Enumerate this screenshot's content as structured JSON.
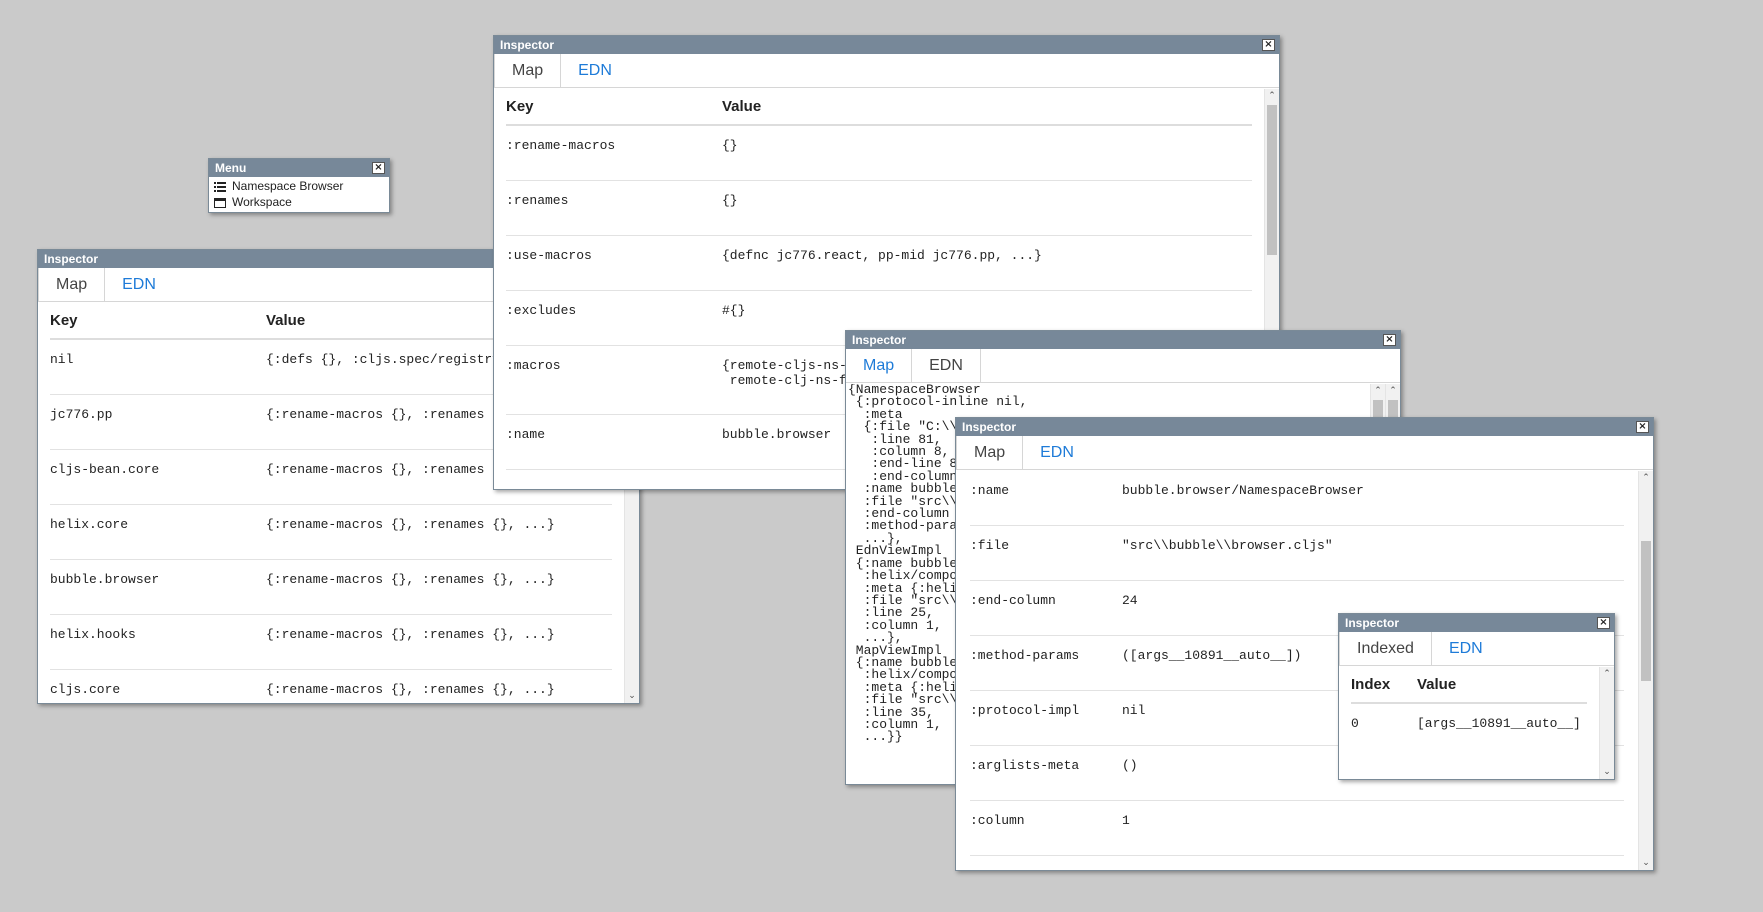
{
  "colors": {
    "background": "#cacaca",
    "titlebar": "#778899",
    "link_tab": "#1e7bd8"
  },
  "close_glyph": "×",
  "menu": {
    "title": "Menu",
    "items": [
      {
        "icon": "list-icon",
        "label": "Namespace Browser"
      },
      {
        "icon": "window-icon",
        "label": "Workspace"
      }
    ]
  },
  "inspector_left": {
    "title": "Inspector",
    "tabs": [
      "Map",
      "EDN"
    ],
    "active_tab": "Map",
    "headers": {
      "key": "Key",
      "value": "Value"
    },
    "rows": [
      {
        "key": "nil",
        "value": "{:defs {}, :cljs.spec/registry-ref []}"
      },
      {
        "key": "jc776.pp",
        "value": "{:rename-macros {}, :renames {}, ...}"
      },
      {
        "key": "cljs-bean.core",
        "value": "{:rename-macros {}, :renames {}, ...}"
      },
      {
        "key": "helix.core",
        "value": "{:rename-macros {}, :renames {}, ...}"
      },
      {
        "key": "bubble.browser",
        "value": "{:rename-macros {}, :renames {}, ...}"
      },
      {
        "key": "helix.hooks",
        "value": "{:rename-macros {}, :renames {}, ...}"
      },
      {
        "key": "cljs.core",
        "value": "{:rename-macros {}, :renames {}, ...}"
      }
    ]
  },
  "inspector_top": {
    "title": "Inspector",
    "tabs": [
      "Map",
      "EDN"
    ],
    "active_tab": "Map",
    "headers": {
      "key": "Key",
      "value": "Value"
    },
    "rows": [
      {
        "key": ":rename-macros",
        "value": "{}"
      },
      {
        "key": ":renames",
        "value": "{}"
      },
      {
        "key": ":use-macros",
        "value": "{defnc jc776.react, pp-mid jc776.pp, ...}"
      },
      {
        "key": ":excludes",
        "value": "#{}"
      },
      {
        "key": ":macros",
        "value": "{remote-cljs-ns-fn bubble.macros,\n remote-clj-ns-fn bubble.macros}"
      },
      {
        "key": ":name",
        "value": "bubble.browser"
      }
    ]
  },
  "inspector_edn": {
    "title": "Inspector",
    "tabs": [
      "Map",
      "EDN"
    ],
    "active_tab": "EDN",
    "text": "{NamespaceBrowser\n {:protocol-inline nil,\n  :meta\n  {:file \"C:\\\\Users\\\\jc776\\\\bubble\\\\src\\\\bubble\\\\browser.cljs\",\n   :line 81,\n   :column 8,\n   :end-line 81,\n   :end-column 24},\n  :name bubble.browser/NamespaceBrowser,\n  :file \"src\\\\bubble\\\\browser.cljs\",\n  :end-column 24,\n  :method-params ([args__10891__auto__]),\n  ...},\n EdnViewImpl\n {:name bubble.browser/EdnViewImpl,\n  :helix/component? true,\n  :meta {:helix/component? true},\n  :file \"src\\\\bubble\\\\browser.cljs\",\n  :line 25,\n  :column 1,\n  ...},\n MapViewImpl\n {:name bubble.browser/MapViewImpl,\n  :helix/component? true,\n  :meta {:helix/component? true},\n  :file \"src\\\\bubble\\\\browser.cljs\",\n  :line 35,\n  :column 1,\n  ...}}"
  },
  "inspector_main": {
    "title": "Inspector",
    "tabs": [
      "Map",
      "EDN"
    ],
    "active_tab": "Map",
    "rows": [
      {
        "key": ":name",
        "value": "bubble.browser/NamespaceBrowser"
      },
      {
        "key": ":file",
        "value": "\"src\\\\bubble\\\\browser.cljs\""
      },
      {
        "key": ":end-column",
        "value": "24"
      },
      {
        "key": ":method-params",
        "value": "([args__10891__auto__])"
      },
      {
        "key": ":protocol-impl",
        "value": "nil"
      },
      {
        "key": ":arglists-meta",
        "value": "()"
      },
      {
        "key": ":column",
        "value": "1"
      }
    ]
  },
  "inspector_small": {
    "title": "Inspector",
    "tabs": [
      "Indexed",
      "EDN"
    ],
    "active_tab": "Indexed",
    "headers": {
      "index": "Index",
      "value": "Value"
    },
    "rows": [
      {
        "index": "0",
        "value": "[args__10891__auto__]"
      }
    ]
  }
}
